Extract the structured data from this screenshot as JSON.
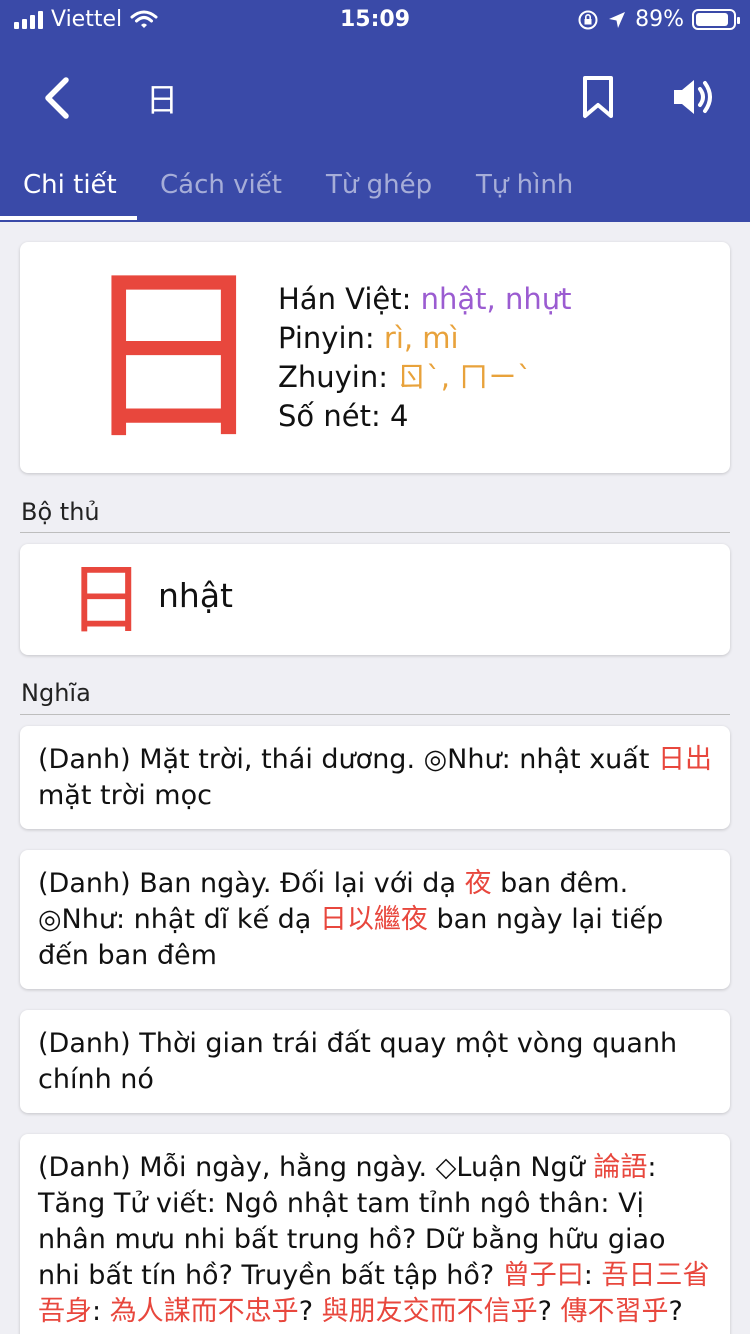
{
  "status_bar": {
    "carrier": "Viettel",
    "time": "15:09",
    "battery": "89%",
    "battery_level": 0.89
  },
  "header": {
    "title": "日",
    "back_icon": "chevron-left-icon",
    "bookmark_icon": "bookmark-icon",
    "sound_icon": "speaker-icon",
    "color": "#3a4aa8"
  },
  "tabs": [
    {
      "label": "Chi tiết",
      "active": true
    },
    {
      "label": "Cách viết",
      "active": false
    },
    {
      "label": "Từ ghép",
      "active": false
    },
    {
      "label": "Tự hình",
      "active": false
    }
  ],
  "character": {
    "glyph": "日",
    "han_viet_label": "Hán Việt: ",
    "han_viet": "nhật, nhựt",
    "pinyin_label": "Pinyin: ",
    "pinyin": "rì, mì",
    "zhuyin_label": "Zhuyin: ",
    "zhuyin": "ㄖˋ, ㄇㄧˋ",
    "strokes_label": "Số nét: ",
    "strokes": "4"
  },
  "radical": {
    "section_label": "Bộ thủ",
    "glyph": "日",
    "name": "nhật"
  },
  "meanings": {
    "section_label": "Nghĩa",
    "m1": {
      "a": "(Danh) Mặt trời, thái dương. ◎Như: nhật xuất ",
      "b": "日出",
      "c": " mặt trời mọc"
    },
    "m2": {
      "a": "(Danh) Ban ngày. Đối lại với dạ ",
      "b": "夜",
      "c": " ban đêm. ◎Như: nhật dĩ kế dạ ",
      "d": "日以繼夜",
      "e": " ban ngày lại tiếp đến ban đêm"
    },
    "m3": {
      "a": "(Danh) Thời gian trái đất quay một vòng quanh chính nó"
    },
    "m4": {
      "a": "(Danh) Mỗi ngày, hằng ngày. ◇Luận Ngữ ",
      "b": "論語",
      "c": ": Tăng Tử viết: Ngô nhật tam tỉnh ngô thân: Vị nhân mưu nhi bất trung hồ? Dữ bằng hữu giao nhi bất tín hồ? Truyền bất tập hồ? ",
      "d": "曾子曰",
      "e": ": ",
      "f": "吾日三省吾身",
      "g": ": ",
      "h": "為人謀而不忠乎",
      "i": "? ",
      "j": "與朋友交而不信乎",
      "k": "? ",
      "l": "傳不習乎",
      "m": "?"
    }
  },
  "colors": {
    "accent": "#3a4aa8",
    "hanzi_red": "#e8473d",
    "han_viet_purple": "#9b5cd1",
    "pinyin_orange": "#e8a23b"
  }
}
